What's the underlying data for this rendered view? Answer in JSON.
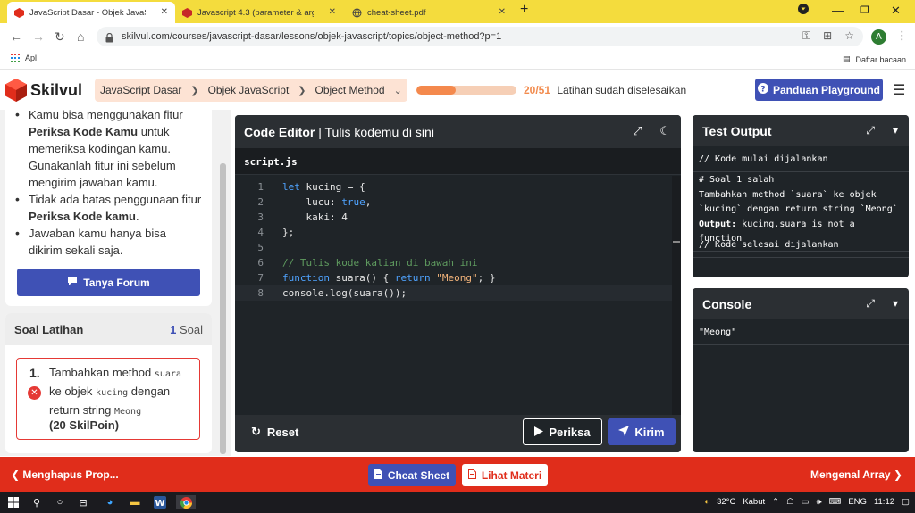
{
  "browser": {
    "tabs": [
      {
        "title": "JavaScript Dasar - Objek JavaScript",
        "active": true
      },
      {
        "title": "Javascript 4.3 (parameter & argume",
        "active": false
      },
      {
        "title": "cheat-sheet.pdf",
        "active": false
      }
    ],
    "url": "skilvul.com/courses/javascript-dasar/lessons/objek-javascript/topics/object-method?p=1",
    "avatar_letter": "A",
    "bookmarks_apps_label": "Apl",
    "reading_list_label": "Daftar bacaan"
  },
  "app": {
    "logo_text": "Skilvul",
    "breadcrumb": [
      "JavaScript Dasar",
      "Objek JavaScript",
      "Object Method"
    ],
    "progress": {
      "done": 20,
      "total": 51,
      "count_text": "20/51",
      "label": "Latihan sudah diselesaikan"
    },
    "guide_button": "Panduan Playground",
    "brand_color": "#3f51b5"
  },
  "instructions": {
    "bullets": [
      {
        "pre": "Kamu bisa menggunakan fitur ",
        "bold": "Periksa Kode Kamu",
        "post": " untuk memeriksa kodingan kamu. Gunakanlah fitur ini sebelum mengirim jawaban kamu."
      },
      {
        "pre": "Tidak ada batas penggunaan fitur ",
        "bold": "Periksa Kode kamu",
        "post": "."
      },
      {
        "pre": "Jawaban kamu hanya bisa dikirim sekali saja.",
        "bold": "",
        "post": ""
      }
    ],
    "forum_button": "Tanya Forum"
  },
  "exercises": {
    "title": "Soal Latihan",
    "count": "1",
    "count_label": "Soal",
    "items": [
      {
        "number": "1.",
        "text_parts": [
          "Tambahkan method ",
          "suara",
          " ke objek ",
          "kucing",
          " dengan return string ",
          "Meong"
        ],
        "points": "(20 SkilPoin)",
        "status": "failed"
      }
    ]
  },
  "editor": {
    "title_bold": "Code Editor",
    "title_rest": " | Tulis kodemu di sini",
    "file_name": "script.js",
    "lines": [
      {
        "n": "1",
        "tokens": [
          {
            "t": "let",
            "c": "kw"
          },
          {
            "t": " kucing = {",
            "c": ""
          }
        ]
      },
      {
        "n": "2",
        "tokens": [
          {
            "t": "    lucu: ",
            "c": ""
          },
          {
            "t": "true",
            "c": "bool"
          },
          {
            "t": ",",
            "c": ""
          }
        ]
      },
      {
        "n": "3",
        "tokens": [
          {
            "t": "    kaki: 4",
            "c": ""
          }
        ]
      },
      {
        "n": "4",
        "tokens": [
          {
            "t": "};",
            "c": ""
          }
        ]
      },
      {
        "n": "5",
        "tokens": []
      },
      {
        "n": "6",
        "tokens": [
          {
            "t": "// Tulis kode kalian di bawah ini",
            "c": "cm"
          }
        ]
      },
      {
        "n": "7",
        "tokens": [
          {
            "t": "function",
            "c": "kw"
          },
          {
            "t": " suara() { ",
            "c": ""
          },
          {
            "t": "return",
            "c": "kw"
          },
          {
            "t": " ",
            "c": ""
          },
          {
            "t": "\"Meong\"",
            "c": "str"
          },
          {
            "t": "; }",
            "c": ""
          }
        ]
      },
      {
        "n": "8",
        "tokens": [
          {
            "t": "console.log(suara());",
            "c": ""
          }
        ]
      }
    ],
    "reset_label": "Reset",
    "check_label": "Periksa",
    "submit_label": "Kirim"
  },
  "test_output": {
    "title": "Test Output",
    "start_line": "// Kode mulai dijalankan",
    "result_title": "# Soal 1 salah",
    "result_desc": "Tambahkan method `suara` ke objek `kucing` dengan return string `Meong`",
    "output_label": "Output:",
    "output_text": " kucing.suara is not a function",
    "end_line": "// Kode selesai dijalankan"
  },
  "console": {
    "title": "Console",
    "lines": [
      "\"Meong\""
    ]
  },
  "bottom_nav": {
    "prev_label": "Menghapus Prop...",
    "next_label": "Mengenal Array",
    "cheat_label": "Cheat Sheet",
    "materi_label": "Lihat Materi",
    "bar_color": "#e02d1b"
  },
  "taskbar": {
    "weather": "32°C",
    "weather_desc": "Kabut",
    "lang": "ENG",
    "time": "11:12"
  }
}
